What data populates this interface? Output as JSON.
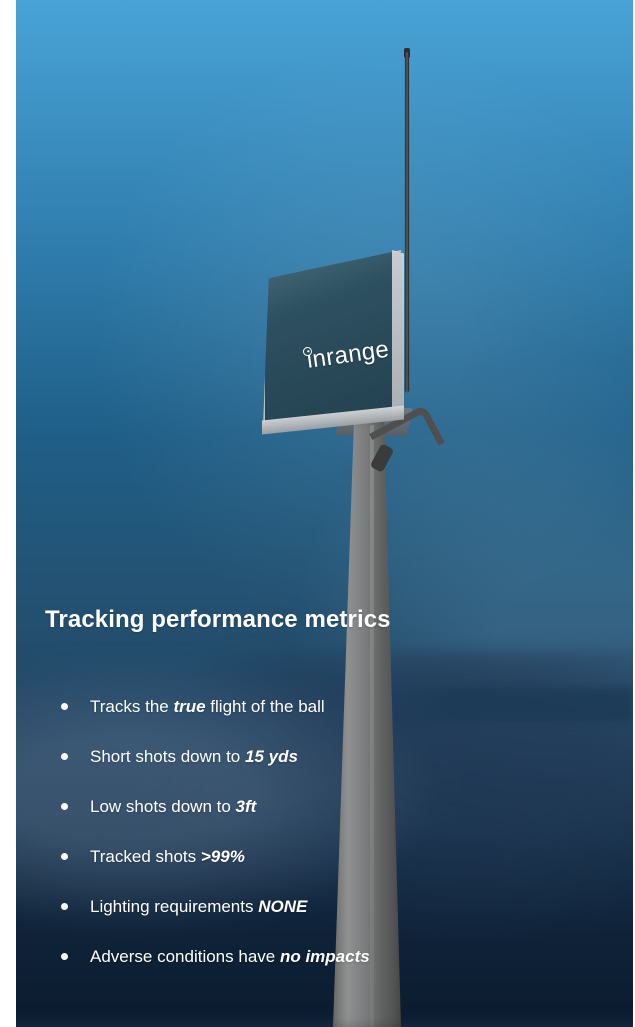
{
  "colors": {
    "sky_top": "#49a3d7",
    "sky_mid": "#1f5f88",
    "ground_dark": "#17354f",
    "text": "#ffffff",
    "pole": "#7a7c7d"
  },
  "device": {
    "brand_label": "inrange"
  },
  "section": {
    "title": "Tracking performance metrics"
  },
  "metrics": [
    {
      "prefix": "Tracks the ",
      "emphasis": "true",
      "suffix": " flight of the ball"
    },
    {
      "prefix": "Short shots down to ",
      "emphasis": "15 yds",
      "suffix": ""
    },
    {
      "prefix": "Low shots down to ",
      "emphasis": "3ft",
      "suffix": ""
    },
    {
      "prefix": "Tracked shots ",
      "emphasis": ">99%",
      "suffix": ""
    },
    {
      "prefix": "Lighting requirements ",
      "emphasis": "NONE",
      "suffix": ""
    },
    {
      "prefix": "Adverse conditions have ",
      "emphasis": "no impacts",
      "suffix": ""
    }
  ]
}
